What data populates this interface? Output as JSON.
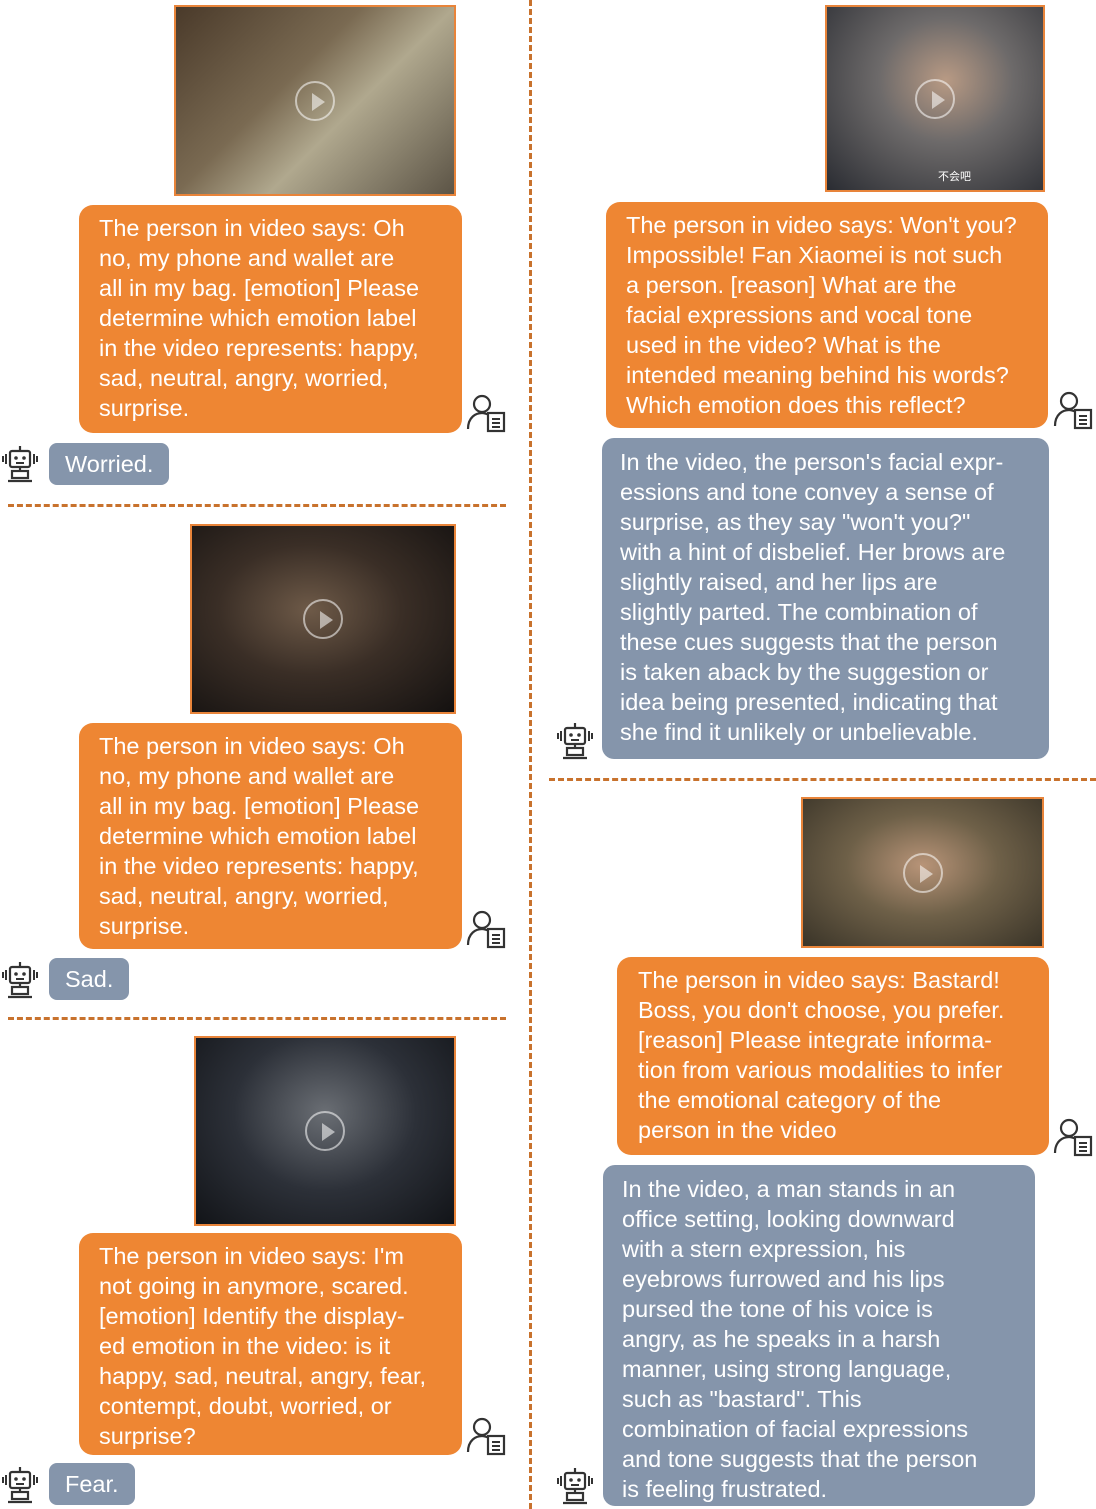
{
  "left_column": [
    {
      "user_message": "The person in video says: Oh\nno, my phone and wallet are\nall in my bag. [emotion] Please\ndetermine which emotion label\nin the video represents: happy,\nsad, neutral, angry, worried,\nsurprise.",
      "model_answer": "Worried."
    },
    {
      "user_message": "The person in video says: Oh\nno, my phone and wallet are\nall in my bag. [emotion] Please\ndetermine which emotion label\nin the video represents: happy,\nsad, neutral, angry, worried,\nsurprise.",
      "model_answer": "Sad."
    },
    {
      "user_message": "The person in video says: I'm\nnot going in anymore, scared.\n[emotion] Identify the display-\ned emotion in the video: is it\nhappy, sad, neutral, angry, fear,\ncontempt, doubt, worried, or\nsurprise?",
      "model_answer": "Fear."
    }
  ],
  "right_column": [
    {
      "video_caption": "不会吧",
      "user_message": "The person in video says: Won't you?\nImpossible! Fan Xiaomei is not such\na person.  [reason] What are the\nfacial expressions and vocal tone\nused in the video? What is the\nintended meaning behind his words?\nWhich emotion does this reflect?",
      "model_answer": "In the video, the person's facial expr-\nessions and tone convey a sense of\nsurprise, as they say \"won't you?\"\nwith a hint of disbelief. Her brows are\nslightly raised, and her lips are\nslightly parted.  The combination of\nthese cues suggests that the person\nis taken aback by the suggestion or\nidea being presented, indicating that\nshe find it unlikely or unbelievable."
    },
    {
      "user_message": "The person in video says: Bastard!\nBoss, you don't choose, you prefer.\n[reason] Please integrate informa-\ntion from various modalities to infer\nthe emotional category of the\nperson in the video",
      "model_answer": "In the video, a man stands in an\noffice setting, looking downward\nwith a stern expression, his\neyebrows furrowed and his lips\npursed the tone of his voice is\nangry, as he speaks in a harsh\nmanner, using strong language,\nsuch as \"bastard\".  This\ncombination of facial expressions\nand tone suggests that the person\nis feeling frustrated."
    }
  ],
  "colors": {
    "user_bubble": "#ee8633",
    "model_bubble": "#8595ab",
    "divider": "#c8722d",
    "icon_stroke": "#333333"
  },
  "icons": {
    "user": "user-with-document-icon",
    "model": "robot-icon",
    "video": "play-icon"
  }
}
